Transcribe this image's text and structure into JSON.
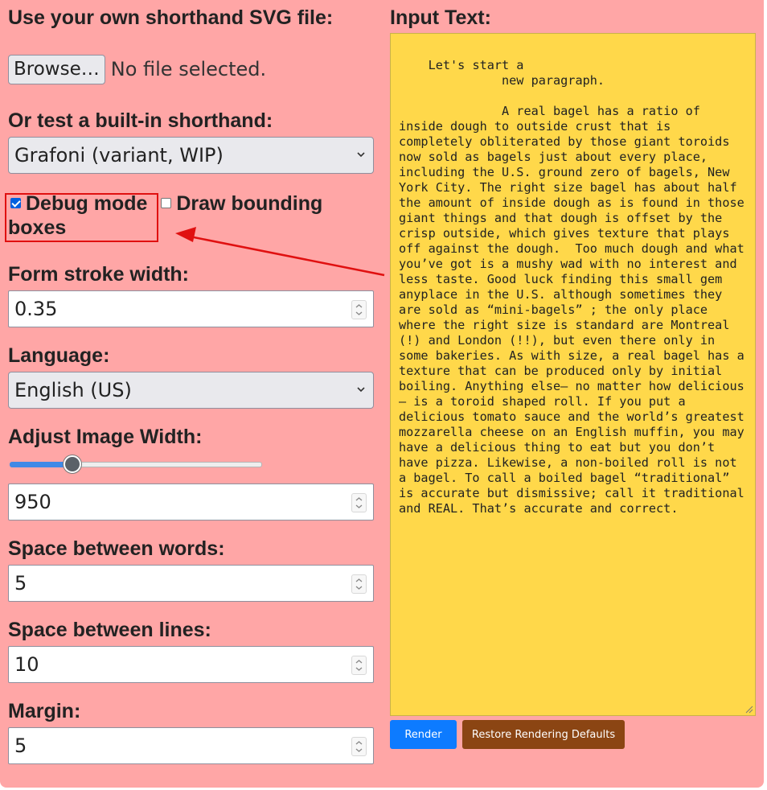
{
  "file": {
    "heading": "Use your own shorthand SVG file:",
    "browse_label": "Browse…",
    "status": "No file selected."
  },
  "builtin": {
    "heading": "Or test a built-in shorthand:",
    "selected": "Grafoni (variant, WIP)"
  },
  "checks": {
    "debug_label": "Debug mode",
    "debug_checked": true,
    "bounding_label": "Draw bounding boxes",
    "bounding_checked": false
  },
  "stroke": {
    "label": "Form stroke width:",
    "value": "0.35"
  },
  "language": {
    "label": "Language:",
    "selected": "English (US)"
  },
  "image_width": {
    "label": "Adjust Image Width:",
    "slider_fraction": 0.25,
    "value": "950"
  },
  "word_space": {
    "label": "Space between words:",
    "value": "5"
  },
  "line_space": {
    "label": "Space between lines:",
    "value": "10"
  },
  "margin": {
    "label": "Margin:",
    "value": "5"
  },
  "input": {
    "heading": "Input Text:",
    "text": "Let's start a \n              new paragraph.\n\n              A real bagel has a ratio of inside dough to outside crust that is completely obliterated by those giant toroids now sold as bagels just about every place, including the U.S. ground zero of bagels, New York City. The right size bagel has about half the amount of inside dough as is found in those giant things and that dough is offset by the crisp outside, which gives texture that plays off against the dough.  Too much dough and what you’ve got is a mushy wad with no interest and less taste. Good luck finding this small gem anyplace in the U.S. although sometimes they are sold as “mini-bagels” ; the only place where the right size is standard are Montreal (!) and London (!!), but even there only in some bakeries. As with size, a real bagel has a texture that can be produced only by initial boiling. Anything else— no matter how delicious — is a toroid shaped roll. If you put a delicious tomato sauce and the world’s greatest mozzarella cheese on an English muffin, you may have a delicious thing to eat but you don’t have pizza. Likewise, a non-boiled roll is not a bagel. To call a boiled bagel “traditional” is accurate but dismissive; call it traditional and REAL. That’s accurate and correct."
  },
  "buttons": {
    "render": "Render",
    "restore": "Restore Rendering Defaults"
  },
  "colors": {
    "panel": "#ffa6a6",
    "textarea": "#ffd84a",
    "render_button": "#0d7bff",
    "restore_button": "#8b4513",
    "annotation": "#e01010"
  }
}
